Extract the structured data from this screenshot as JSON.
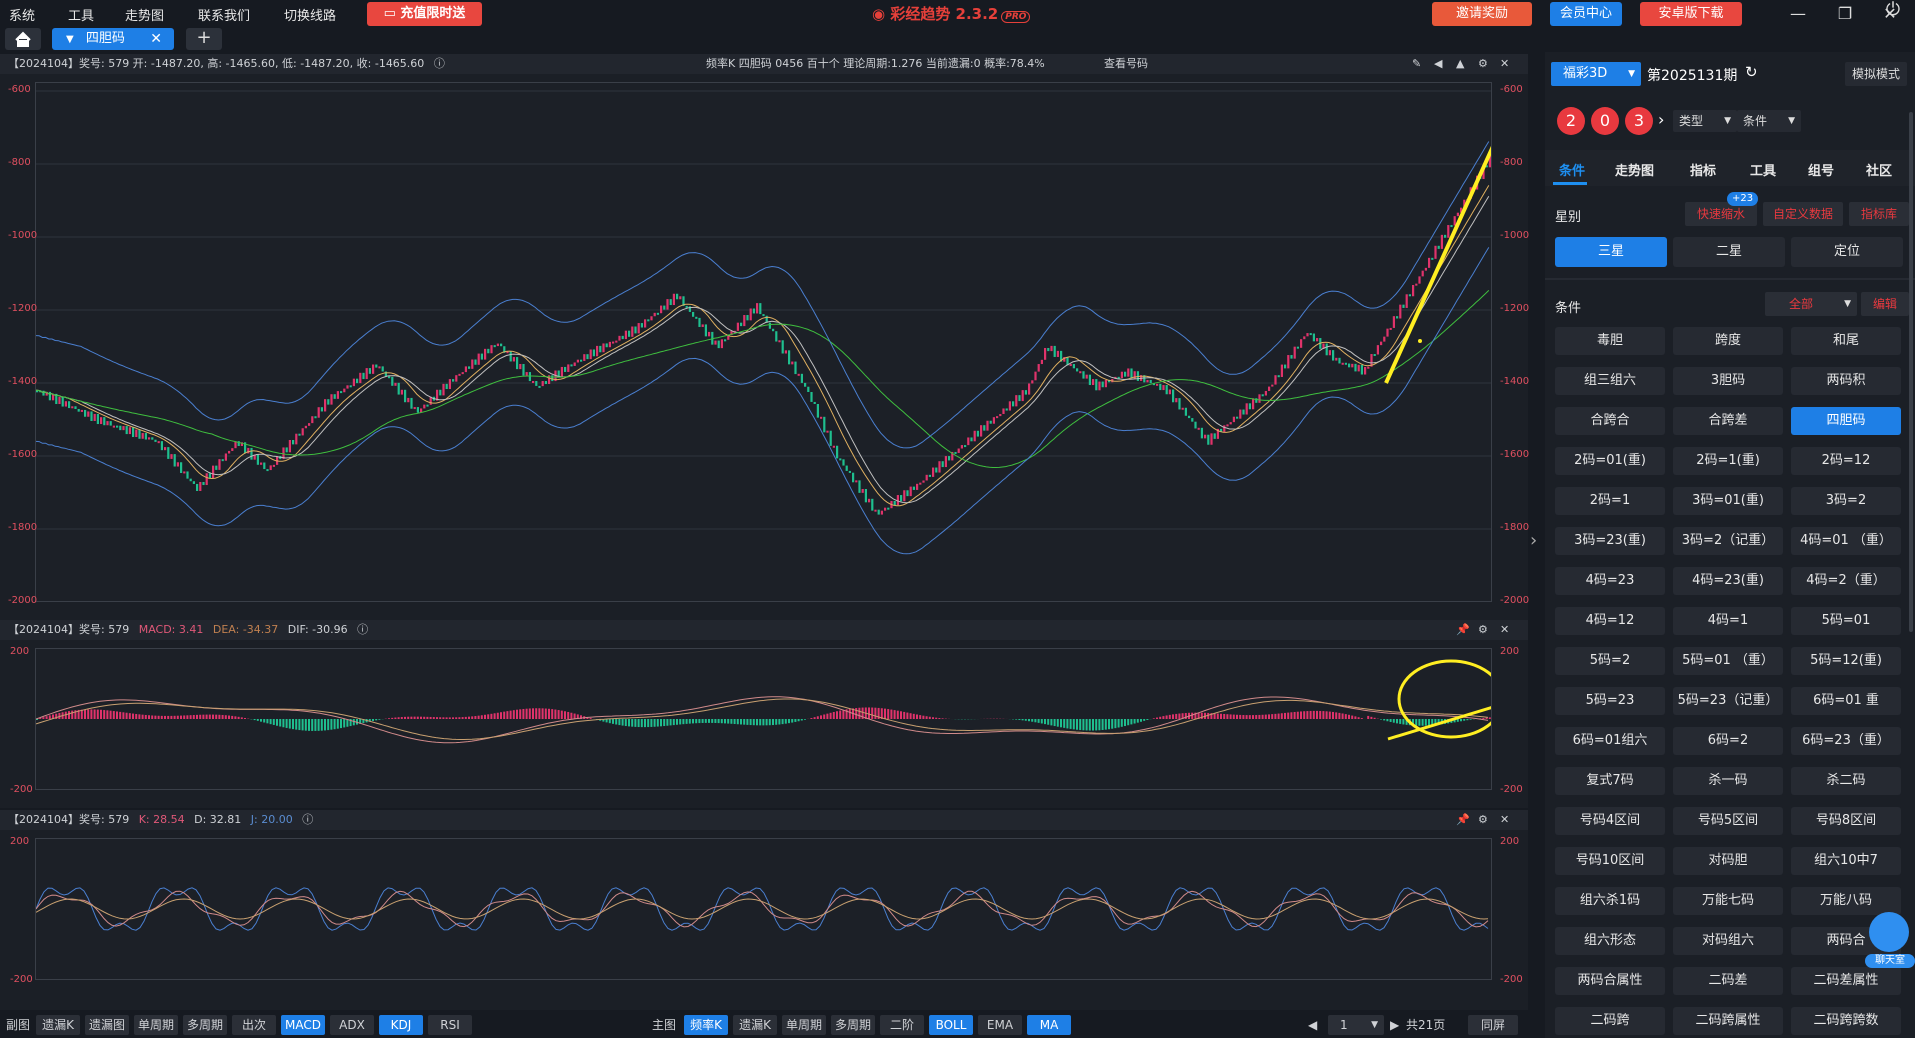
{
  "menu": [
    "系统",
    "工具",
    "走势图",
    "联系我们",
    "切换线路"
  ],
  "promo_label": "充值限时送",
  "app_title": "彩经趋势 2.3.2",
  "app_badge": "PRO",
  "invite_label": "邀请奖励",
  "member_label": "会员中心",
  "android_label": "安卓版下载",
  "tab_label": "四胆码",
  "panel1": {
    "info": "【2024104】奖号: 579  开: -1487.20, 高: -1465.60, 低: -1487.20, 收: -1465.60",
    "stats": "频率K  四胆码  0456  百十个  理论周期:1.276  当前遗漏:0  概率:78.4%",
    "view_label": "查看号码",
    "yticks": [
      "-600",
      "-800",
      "-1000",
      "-1200",
      "-1400",
      "-1600",
      "-1800",
      "-2000"
    ]
  },
  "panel2": {
    "info": "【2024104】奖号: 579",
    "macd": "MACD: 3.41",
    "dea": "DEA: -34.37",
    "dif": "DIF: -30.96",
    "yticks": [
      "200",
      "-200"
    ]
  },
  "panel3": {
    "info": "【2024104】奖号: 579",
    "k": "K: 28.54",
    "d": "D: 32.81",
    "j": "J: 20.00",
    "yticks": [
      "200",
      "-200"
    ]
  },
  "bottom_left": {
    "label": "副图",
    "buttons": [
      {
        "label": "遗漏K",
        "on": false
      },
      {
        "label": "遗漏图",
        "on": false
      },
      {
        "label": "单周期",
        "on": false
      },
      {
        "label": "多周期",
        "on": false
      },
      {
        "label": "出次",
        "on": false
      },
      {
        "label": "MACD",
        "on": true
      },
      {
        "label": "ADX",
        "on": false
      },
      {
        "label": "KDJ",
        "on": true
      },
      {
        "label": "RSI",
        "on": false
      }
    ]
  },
  "bottom_right": {
    "label": "主图",
    "buttons": [
      {
        "label": "频率K",
        "on": true
      },
      {
        "label": "遗漏K",
        "on": false
      },
      {
        "label": "单周期",
        "on": false
      },
      {
        "label": "多周期",
        "on": false
      },
      {
        "label": "二阶",
        "on": false
      },
      {
        "label": "BOLL",
        "on": true
      },
      {
        "label": "EMA",
        "on": false
      },
      {
        "label": "MA",
        "on": true
      }
    ],
    "page_value": "1",
    "page_total": "共21页",
    "fullscreen": "同屏"
  },
  "right": {
    "lottery": "福彩3D",
    "period": "第2025131期",
    "mode": "模拟模式",
    "balls": [
      "2",
      "0",
      "3"
    ],
    "type_label": "类型",
    "cond_label": "条件",
    "tabs": [
      "条件",
      "走势图",
      "指标",
      "工具",
      "组号",
      "社区"
    ],
    "star_label": "星别",
    "quick_shrink": "快速缩水",
    "quick_badge": "+23",
    "custom_data": "自定义数据",
    "indicator_lib": "指标库",
    "star_buttons": [
      "三星",
      "二星",
      "定位"
    ],
    "conditions_label": "条件",
    "all_label": "全部",
    "edit_label": "编辑",
    "chat_label": "聊天室",
    "grid": [
      "毒胆",
      "跨度",
      "和尾",
      "组三组六",
      "3胆码",
      "两码积",
      "合跨合",
      "合跨差",
      "四胆码",
      "2码=01(重)",
      "2码=1(重)",
      "2码=12",
      "2码=1",
      "3码=01(重)",
      "3码=2",
      "3码=23(重)",
      "3码=2（记重）",
      "4码=01 （重）",
      "4码=23",
      "4码=23(重)",
      "4码=2（重）",
      "4码=12",
      "4码=1",
      "5码=01",
      "5码=2",
      "5码=01 （重）",
      "5码=12(重)",
      "5码=23",
      "5码=23（记重）",
      "6码=01 重",
      "6码=01组六",
      "6码=2",
      "6码=23（重）",
      "复式7码",
      "杀一码",
      "杀二码",
      "号码4区间",
      "号码5区间",
      "号码8区间",
      "号码10区间",
      "对码胆",
      "组六10中7",
      "组六杀1码",
      "万能七码",
      "万能八码",
      "组六形态",
      "对码组六",
      "两码合",
      "两码合属性",
      "二码差",
      "二码差属性",
      "二码跨",
      "二码跨属性",
      "二码跨跨数"
    ],
    "grid_active": "四胆码"
  }
}
